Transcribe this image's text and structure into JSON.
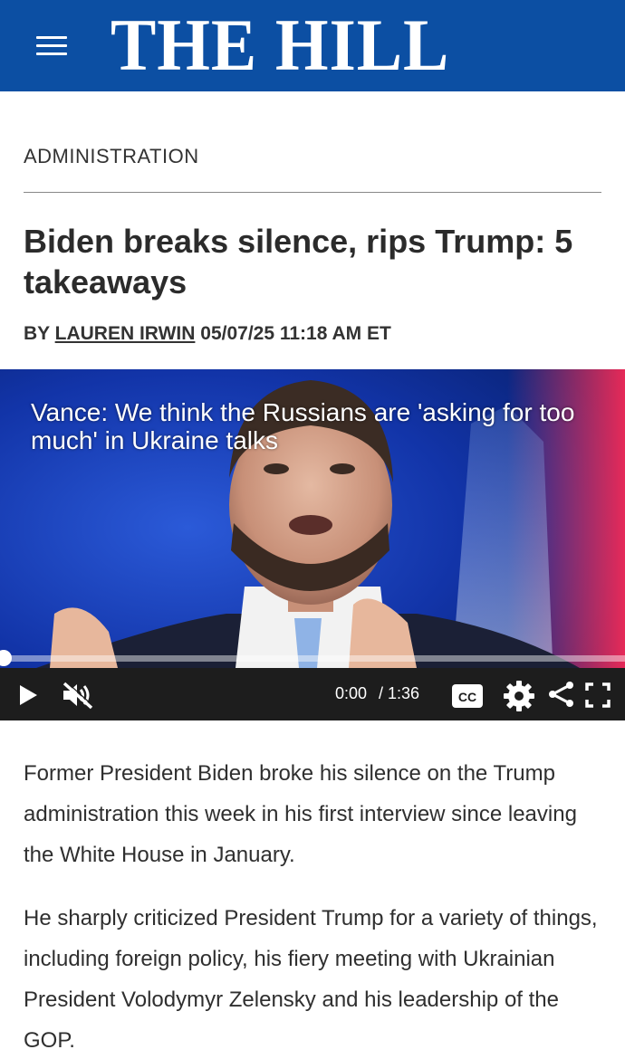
{
  "header": {
    "logo_text": "THE HILL",
    "menu_icon": "hamburger-menu-icon",
    "background_color": "#0c4fa3"
  },
  "article": {
    "section": "ADMINISTRATION",
    "title": "Biden breaks silence, rips Trump: 5 takeaways",
    "byline_prefix": "BY",
    "author": "LAUREN IRWIN",
    "timestamp": "05/07/25 11:18 AM ET",
    "paragraphs": [
      "Former President Biden broke his silence on the Trump administration this week in his first interview since leaving the White House in January.",
      "He sharply criticized President Trump for a variety of things, including foreign policy, his fiery meeting with Ukrainian President Volodymyr Zelensky and his leadership of the GOP."
    ]
  },
  "video": {
    "caption": "Vance: We think the Russians are 'asking for too much' in Ukraine talks",
    "current_time": "0:00",
    "duration": "/ 1:36",
    "progress": 0,
    "icons": [
      "play-icon",
      "muted-volume-icon",
      "closed-captions-icon",
      "settings-gear-icon",
      "share-icon",
      "fullscreen-icon"
    ],
    "cc_label": "CC"
  }
}
